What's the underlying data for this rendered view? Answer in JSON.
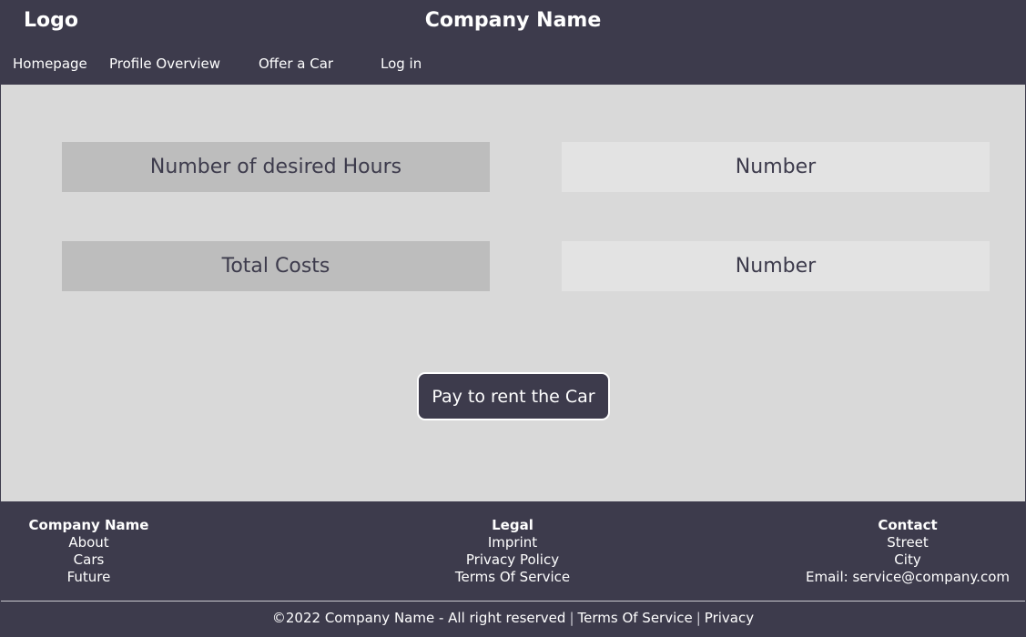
{
  "header": {
    "logo": "Logo",
    "company_name": "Company Name",
    "nav": [
      "Homepage",
      "Profile Overview",
      "Offer a Car",
      "Log in"
    ]
  },
  "main": {
    "rows": [
      {
        "label": "Number of desired Hours",
        "value": "Number"
      },
      {
        "label": "Total Costs",
        "value": "Number"
      }
    ],
    "pay_button": "Pay to rent the Car"
  },
  "footer": {
    "columns": [
      {
        "title": "Company Name",
        "items": [
          "About",
          "Cars",
          "Future"
        ]
      },
      {
        "title": "Legal",
        "items": [
          "Imprint",
          "Privacy Policy",
          "Terms Of Service"
        ]
      },
      {
        "title": "Contact",
        "items": [
          "Street",
          "City",
          "Email: service@company.com"
        ]
      }
    ],
    "copyright": "©2022 Company Name - All right reserved",
    "terms_link": "Terms Of Service",
    "privacy_link": "Privacy",
    "separator": "|"
  },
  "colors": {
    "dark": "#3d3b4c",
    "main_bg": "#d9d9d9",
    "label_box": "#bdbdbd",
    "value_box": "#e3e3e3"
  }
}
